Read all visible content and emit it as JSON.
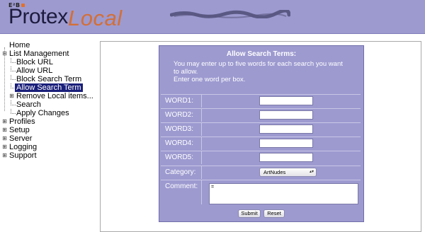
{
  "header": {
    "brand_small": "E²B",
    "logo_primary": "Protex",
    "logo_secondary": "Local"
  },
  "nav": {
    "items": [
      {
        "label": "Home"
      },
      {
        "label": "List Management"
      },
      {
        "label": "Block URL"
      },
      {
        "label": "Allow URL"
      },
      {
        "label": "Block Search Term"
      },
      {
        "label": "Allow Search Term"
      },
      {
        "label": "Remove Local items..."
      },
      {
        "label": "Search"
      },
      {
        "label": "Apply Changes"
      },
      {
        "label": "Profiles"
      },
      {
        "label": "Setup"
      },
      {
        "label": "Server"
      },
      {
        "label": "Logging"
      },
      {
        "label": "Support"
      }
    ]
  },
  "form": {
    "title": "Allow Search Terms:",
    "desc_line1": "You may enter up to five words for each search you want",
    "desc_line2": "to allow.",
    "desc_line3": "Enter one word per box.",
    "word1_label": "WORD1:",
    "word2_label": "WORD2:",
    "word3_label": "WORD3:",
    "word4_label": "WORD4:",
    "word5_label": "WORD5:",
    "word1_value": "",
    "word2_value": "",
    "word3_value": "",
    "word4_value": "",
    "word5_value": "",
    "category_label": "Category:",
    "category_value": "ArtNudes",
    "comment_label": "Comment:",
    "comment_value": "=",
    "submit_label": "Submit",
    "reset_label": "Reset"
  },
  "colors": {
    "header_bg": "#9d9ad0",
    "form_bg": "#9d9ad0",
    "logo_local": "#d36f36",
    "selected_bg": "#1a1f7a"
  }
}
